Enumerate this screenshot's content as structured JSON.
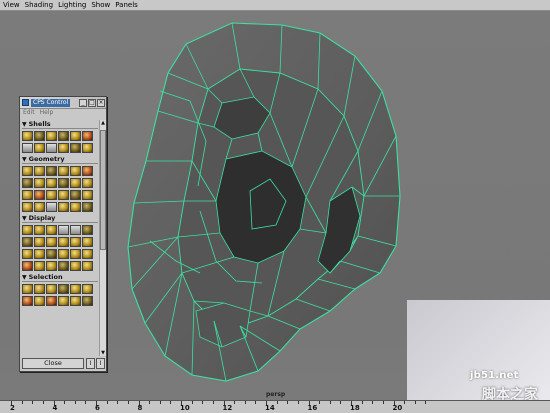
{
  "menubar": {
    "items": [
      "View",
      "Shading",
      "Lighting",
      "Show",
      "Panels"
    ]
  },
  "viewport": {
    "camera_label": "persp"
  },
  "cps_window": {
    "title": "CPS Control",
    "menu": [
      "Edit",
      "Help"
    ],
    "sections": [
      {
        "label": "Shells",
        "rows": 2
      },
      {
        "label": "Geometry",
        "rows": 4
      },
      {
        "label": "Display",
        "rows": 4
      },
      {
        "label": "Selection",
        "rows": 2
      }
    ],
    "close_label": "Close",
    "small_buttons": [
      "I",
      "I"
    ]
  },
  "timeline": {
    "ticks": [
      "2",
      "4",
      "6",
      "8",
      "10",
      "12",
      "14",
      "16",
      "18",
      "20"
    ]
  },
  "watermark": {
    "url": "jb51.net",
    "text": "脚本之家"
  },
  "colors": {
    "wireframe": "#3de0a0",
    "mesh_fill": "#5f5f5f",
    "viewport_bg": "#7a7a7a"
  }
}
